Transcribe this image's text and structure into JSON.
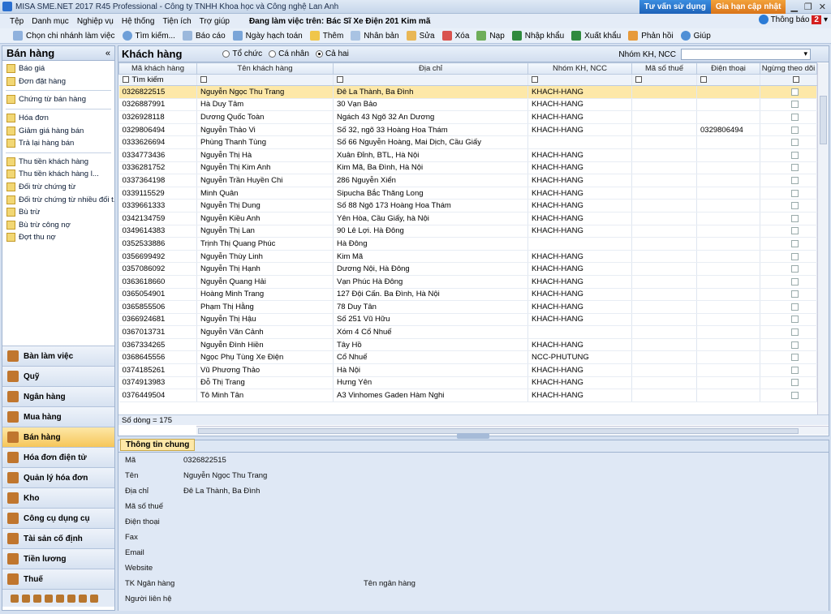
{
  "titlebar": {
    "title": "MISA SME.NET 2017 R45 Professional - Công ty TNHH Khoa học và Công nghệ Lan Anh",
    "consult_btn": "Tư vấn sử dụng",
    "extend_btn": "Gia hạn cập nhật"
  },
  "menu": {
    "items": [
      "Tệp",
      "Danh mục",
      "Nghiệp vụ",
      "Hệ thống",
      "Tiện ích",
      "Trợ giúp"
    ],
    "working": "Đang làm việc trên: Bác Sĩ Xe Điện 201 Kim mã",
    "notify_label": "Thông báo",
    "notify_count": "2"
  },
  "toolbar": {
    "items": [
      "Chọn chi nhánh làm việc",
      "Tìm kiếm...",
      "Báo cáo",
      "Ngày hạch toán",
      "Thêm",
      "Nhân bản",
      "Sửa",
      "Xóa",
      "Nạp",
      "Nhập khẩu",
      "Xuất khẩu",
      "Phản hồi",
      "Giúp"
    ]
  },
  "sidebar": {
    "title": "Bán hàng",
    "collapse": "«",
    "groups": [
      [
        "Báo giá",
        "Đơn đặt hàng"
      ],
      [
        "Chứng từ bán hàng"
      ],
      [
        "Hóa đơn",
        "Giảm giá hàng bán",
        "Trả lại hàng bán"
      ],
      [
        "Thu tiền khách hàng",
        "Thu tiền khách hàng l...",
        "Đối trừ chứng từ",
        "Đối trừ chứng từ nhiều đối t...",
        "Bù trừ",
        "Bù trừ công nợ",
        "Đợt thu nợ"
      ]
    ],
    "modules": [
      "Bàn làm việc",
      "Quỹ",
      "Ngân hàng",
      "Mua hàng",
      "Bán hàng",
      "Hóa đơn điện tử",
      "Quản lý hóa đơn",
      "Kho",
      "Công cụ dụng cụ",
      "Tài sản cố định",
      "Tiền lương",
      "Thuế"
    ],
    "active_module": "Bán hàng"
  },
  "main": {
    "title": "Khách hàng",
    "radios": [
      "Tổ chức",
      "Cá nhân",
      "Cả hai"
    ],
    "radio_selected": "Cả hai",
    "group_label": "Nhóm KH, NCC",
    "columns": [
      "Mã khách hàng",
      "Tên khách hàng",
      "Địa chỉ",
      "Nhóm KH, NCC",
      "Mã số thuế",
      "Điện thoại",
      "Ngừng theo dõi"
    ],
    "filter_text": "Tìm kiếm",
    "rows": [
      [
        "0326822515",
        "Nguyễn Ngọc Thu Trang",
        "Đê La Thành, Ba Đình",
        "KHACH-HANG",
        "",
        ""
      ],
      [
        "0326887991",
        "Hà Duy Tâm",
        "30 Vạn Bảo",
        "KHACH-HANG",
        "",
        ""
      ],
      [
        "0326928118",
        "Dương Quốc Toàn",
        "Ngách 43 Ngõ 32 An Dương",
        "KHACH-HANG",
        "",
        ""
      ],
      [
        "0329806494",
        "Nguyễn Thảo Vi",
        "Số 32, ngõ 33 Hoàng Hoa Thám",
        "KHACH-HANG",
        "",
        "0329806494"
      ],
      [
        "0333626694",
        "Phùng Thanh Tùng",
        "Số 66 Nguyễn Hoàng, Mai Dịch, Cầu Giấy",
        "",
        "",
        ""
      ],
      [
        "0334773436",
        "Nguyễn Thị Hà",
        "Xuân Đỉnh, BTL, Hà Nội",
        "KHACH-HANG",
        "",
        ""
      ],
      [
        "0336281752",
        "Nguyễn Thị Kim Anh",
        "Kim Mã, Ba Đình, Hà Nội",
        "KHACH-HANG",
        "",
        ""
      ],
      [
        "0337364198",
        "Nguyễn Trần Huyền Chi",
        "286 Nguyễn Xiển",
        "KHACH-HANG",
        "",
        ""
      ],
      [
        "0339115529",
        "Minh Quân",
        "Sipucha Bắc Thăng Long",
        "KHACH-HANG",
        "",
        ""
      ],
      [
        "0339661333",
        "Nguyễn Thị Dung",
        "Số 88 Ngõ 173 Hoàng Hoa Thám",
        "KHACH-HANG",
        "",
        ""
      ],
      [
        "0342134759",
        "Nguyễn Kiều Anh",
        "Yên Hòa, Cầu Giấy, hà Nội",
        "KHACH-HANG",
        "",
        ""
      ],
      [
        "0349614383",
        "Nguyễn Thị Lan",
        "90 Lê Lợi. Hà Đông",
        "KHACH-HANG",
        "",
        ""
      ],
      [
        "0352533886",
        "Trịnh Thị Quang Phúc",
        "Hà Đông",
        "",
        "",
        ""
      ],
      [
        "0356699492",
        "Nguyễn Thùy Linh",
        "Kim Mã",
        "KHACH-HANG",
        "",
        ""
      ],
      [
        "0357086092",
        "Nguyễn Thị Hạnh",
        "Dương Nội, Hà Đông",
        "KHACH-HANG",
        "",
        ""
      ],
      [
        "0363618660",
        "Nguyễn Quang Hải",
        "Vạn Phúc Hà Đông",
        "KHACH-HANG",
        "",
        ""
      ],
      [
        "0365054901",
        "Hoàng Minh Trang",
        "127 Đội Cấn. Ba Đình, Hà Nội",
        "KHACH-HANG",
        "",
        ""
      ],
      [
        "0365855506",
        "Phạm Thị Hằng",
        "78 Duy Tân",
        "KHACH-HANG",
        "",
        ""
      ],
      [
        "0366924681",
        "Nguyễn Thị Hậu",
        "Số 251 Vũ Hữu",
        "KHACH-HANG",
        "",
        ""
      ],
      [
        "0367013731",
        "Nguyễn Văn Cảnh",
        "Xóm 4 Cổ Nhuế",
        "",
        "",
        ""
      ],
      [
        "0367334265",
        "Nguyễn Đình Hiền",
        "Tây Hồ",
        "KHACH-HANG",
        "",
        ""
      ],
      [
        "0368645556",
        "Ngọc Phụ Tùng Xe Điện",
        "Cổ Nhuế",
        "NCC-PHUTUNG",
        "",
        ""
      ],
      [
        "0374185261",
        "Vũ Phương Thảo",
        "Hà Nội",
        "KHACH-HANG",
        "",
        ""
      ],
      [
        "0374913983",
        "Đỗ Thị Trang",
        "Hưng Yên",
        "KHACH-HANG",
        "",
        ""
      ],
      [
        "0376449504",
        "Tô Minh Tân",
        "A3 Vinhomes Gaden Hàm Nghi",
        "KHACH-HANG",
        "",
        ""
      ]
    ],
    "row_count": "Số dòng = 175"
  },
  "detail": {
    "tab": "Thông tin chung",
    "labels": [
      "Mã",
      "Tên",
      "Địa chỉ",
      "Mã số thuế",
      "Điện thoại",
      "Fax",
      "Email",
      "Website",
      "TK Ngân hàng",
      "Người liên hệ"
    ],
    "values": [
      "0326822515",
      "Nguyễn Ngọc Thu Trang",
      "Đê La Thành, Ba Đình",
      "",
      "",
      "",
      "",
      "",
      "",
      ""
    ],
    "bank_label": "Tên ngân hàng"
  }
}
